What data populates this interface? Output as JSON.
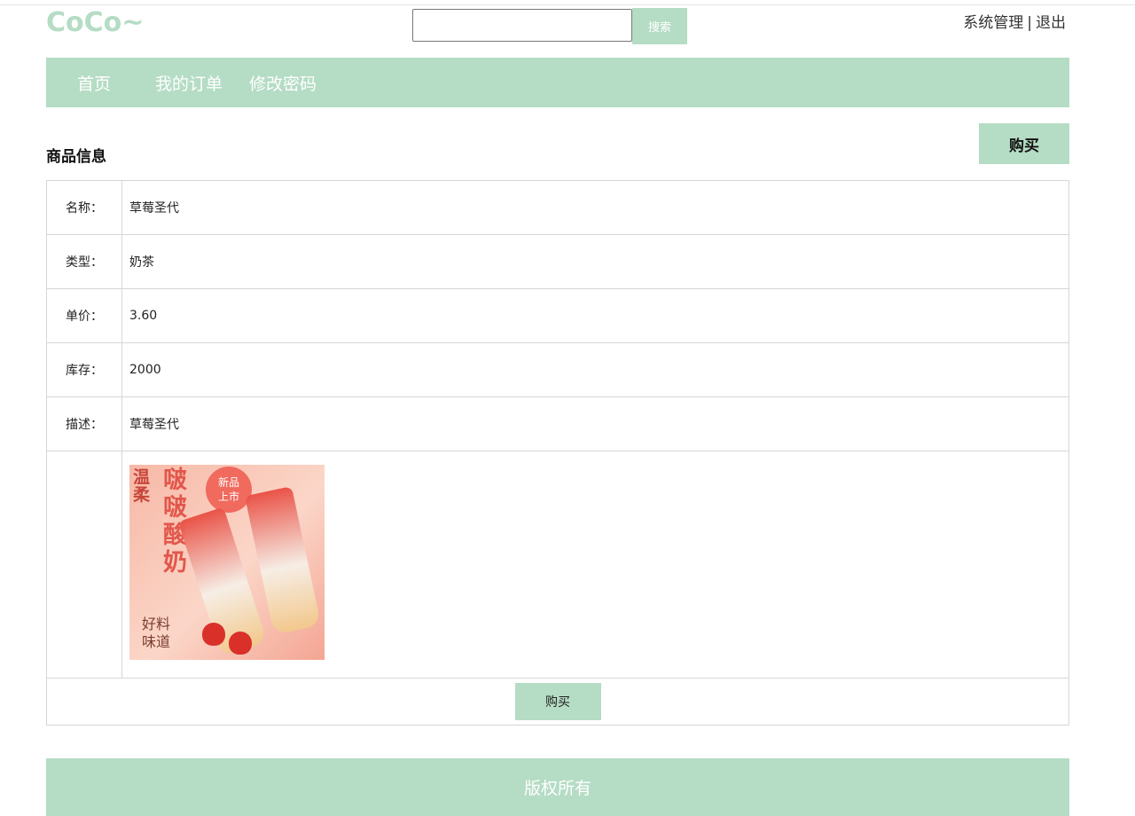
{
  "header": {
    "logo": "CoCo~",
    "search": {
      "placeholder": "",
      "value": "",
      "button_label": "搜索"
    },
    "links": {
      "admin": "系统管理",
      "separator": "|",
      "logout": "退出"
    }
  },
  "nav": {
    "items": [
      {
        "label": "首页"
      },
      {
        "label": "我的订单"
      },
      {
        "label": "修改密码"
      }
    ]
  },
  "main": {
    "section_title": "商品信息",
    "buy_top_label": "购买",
    "fields": [
      {
        "label": "名称：",
        "value": "草莓圣代"
      },
      {
        "label": "类型：",
        "value": "奶茶"
      },
      {
        "label": "单价：",
        "value": "3.60"
      },
      {
        "label": "库存：",
        "value": "2000"
      },
      {
        "label": "描述：",
        "value": "草莓圣代"
      }
    ],
    "image": {
      "side_text": "温柔",
      "big_text": "啵啵酸奶",
      "badge_text": "新品上市",
      "bottom_text": "好料味道"
    },
    "buy_bottom_label": "购买"
  },
  "footer": {
    "text": "版权所有"
  },
  "colors": {
    "accent": "#b5dcc4"
  }
}
